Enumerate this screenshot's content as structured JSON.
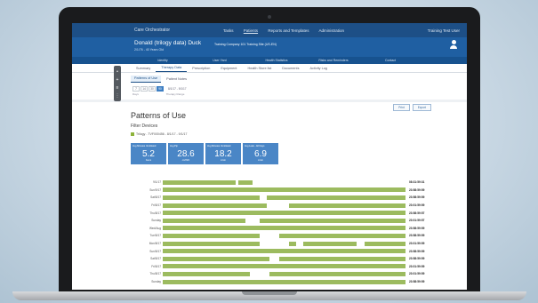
{
  "app": {
    "title": "Care Orchestrator",
    "nav": [
      "Tasks",
      "Patients",
      "Reports and Templates",
      "Administration"
    ],
    "active_nav": 1,
    "user": "Training Test User"
  },
  "patient": {
    "name": "Donald (trilogy data) Duck",
    "meta": "2/1/76 - 40 Years Old",
    "company": "Training Company 101 Training Site (US-EN)",
    "info_strip": [
      "Identity",
      "User Yard",
      "Health Statistics",
      "Risks and Reminders",
      "Contact"
    ]
  },
  "tabs": [
    "Summary",
    "Therapy Data",
    "Prescription",
    "Equipment",
    "Health Store list",
    "Documents",
    "Activity Log"
  ],
  "active_tab": 1,
  "subtabs": [
    "Patterns of Use",
    "Patient Notes"
  ],
  "active_subtab": 0,
  "range": {
    "buttons": [
      "7",
      "14",
      "30",
      "90"
    ],
    "active": 3,
    "dates": "8/1/17 - 9/1/17",
    "left_label": "Days",
    "right_label": "Therapy Range"
  },
  "section": {
    "title": "Patterns of Use",
    "filter_label": "Filter Devices",
    "filter_item": "Trilogy - TVF000456 - 8/1/17 - 9/1/17",
    "print_label": "Print",
    "export_label": "Export"
  },
  "stats": [
    {
      "title": "Avg Minutes Ventilated",
      "value": "5.2",
      "unit": "hours"
    },
    {
      "title": "Avg Pip",
      "value": "28.6",
      "unit": "cmH2O"
    },
    {
      "title": "Avg Minutes Ventilated",
      "value": "18.2",
      "unit": "L/min"
    },
    {
      "title": "Avg Leak - All Days",
      "value": "6.9",
      "unit": "L/min"
    }
  ],
  "usage_rows": [
    {
      "date": "9/1/17",
      "segments": [
        [
          0,
          0.3
        ],
        [
          0.31,
          0.37
        ]
      ],
      "total": "08:31:59:31"
    },
    {
      "date": "Sun/9/17",
      "segments": [
        [
          0,
          1
        ]
      ],
      "total": "23:58:59:59"
    },
    {
      "date": "Sat/8/17",
      "segments": [
        [
          0,
          0.4
        ],
        [
          0.43,
          1
        ]
      ],
      "total": "23:58:59:59"
    },
    {
      "date": "Fri/8/17",
      "segments": [
        [
          0,
          0.43
        ],
        [
          0.52,
          1
        ]
      ],
      "total": "23:01:59:59"
    },
    {
      "date": "Thu/8/17",
      "segments": [
        [
          0,
          1
        ]
      ],
      "total": "23:58:59:57"
    },
    {
      "date": "Sunday",
      "segments": [
        [
          0,
          0.34
        ],
        [
          0.4,
          1
        ]
      ],
      "total": "23:01:59:57"
    },
    {
      "date": "Wed/Aug",
      "segments": [
        [
          0,
          1
        ]
      ],
      "total": "23:58:59:59"
    },
    {
      "date": "Tue/8/17",
      "segments": [
        [
          0,
          0.4
        ],
        [
          0.48,
          1
        ]
      ],
      "total": "23:58:59:59"
    },
    {
      "date": "Mon/8/17",
      "segments": [
        [
          0,
          0.4
        ],
        [
          0.52,
          0.55
        ],
        [
          0.58,
          0.8
        ],
        [
          0.83,
          1
        ]
      ],
      "total": "23:01:59:59"
    },
    {
      "date": "Sun/8/17",
      "segments": [
        [
          0,
          1
        ]
      ],
      "total": "23:58:59:59"
    },
    {
      "date": "Sat/8/17",
      "segments": [
        [
          0,
          0.44
        ],
        [
          0.48,
          1
        ]
      ],
      "total": "23:58:59:59"
    },
    {
      "date": "Fri/8/17",
      "segments": [
        [
          0,
          1
        ]
      ],
      "total": "23:01:59:59"
    },
    {
      "date": "Thu/8/17",
      "segments": [
        [
          0,
          0.36
        ],
        [
          0.44,
          1
        ]
      ],
      "total": "23:01:59:59"
    },
    {
      "date": "Sunday",
      "segments": [
        [
          0,
          1
        ]
      ],
      "total": "23:58:59:59"
    }
  ],
  "colors": {
    "header": "#1d4f86",
    "patient_bar": "#1f5fa2",
    "stat_tile": "#4a86c6",
    "usage_bar": "#9cbb5f"
  }
}
